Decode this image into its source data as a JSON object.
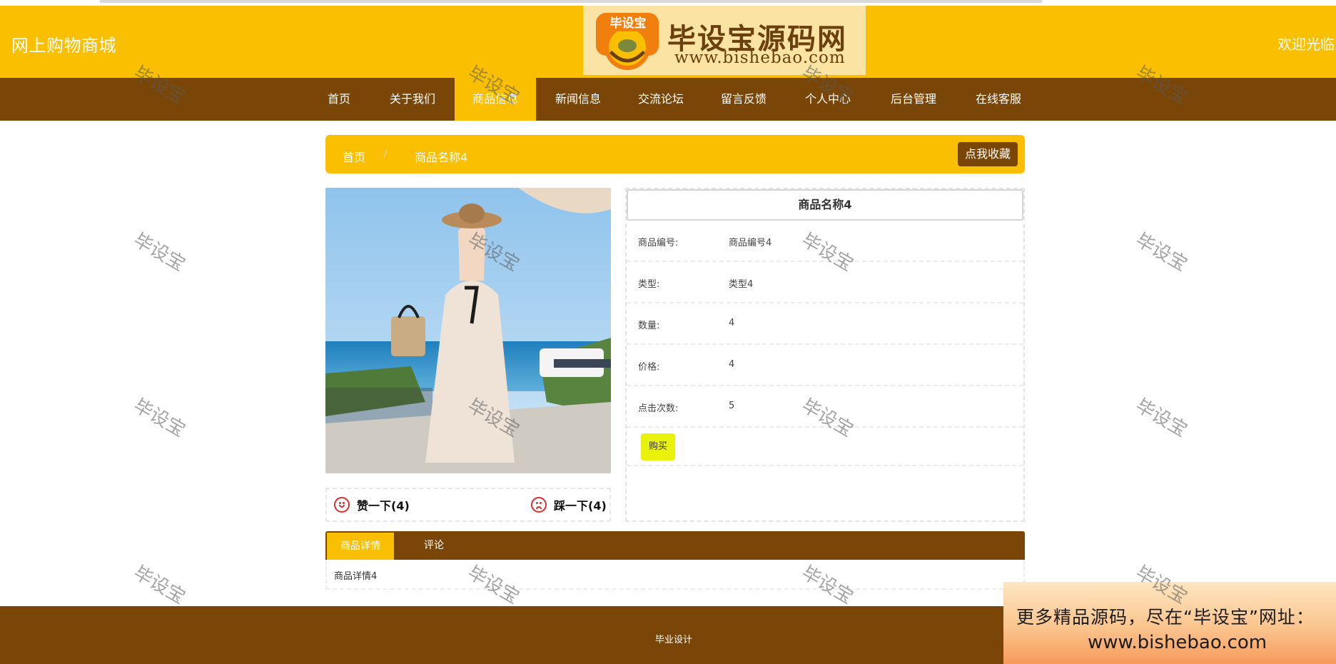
{
  "header": {
    "site_title": "网上购物商城",
    "welcome": "欢迎光临",
    "logo": {
      "badge_text": "毕设宝",
      "title": "毕设宝源码网",
      "url": "www.bishebao.com"
    }
  },
  "nav": {
    "items": [
      {
        "label": "首页"
      },
      {
        "label": "关于我们"
      },
      {
        "label": "商品信息"
      },
      {
        "label": "新闻信息"
      },
      {
        "label": "交流论坛"
      },
      {
        "label": "留言反馈"
      },
      {
        "label": "个人中心"
      },
      {
        "label": "后台管理"
      },
      {
        "label": "在线客服"
      }
    ],
    "active": "商品信息"
  },
  "breadcrumb": {
    "home": "首页",
    "separator": "/",
    "current": "商品名称4",
    "favorite_button": "点我收藏"
  },
  "votes": {
    "like": "赞一下(4)",
    "dislike": "踩一下(4)"
  },
  "product": {
    "name": "商品名称4",
    "fields": [
      {
        "key": "商品编号:",
        "value": "商品编号4"
      },
      {
        "key": "类型:",
        "value": "类型4"
      },
      {
        "key": "数量:",
        "value": "4"
      },
      {
        "key": "价格:",
        "value": "4"
      },
      {
        "key": "点击次数:",
        "value": "5"
      }
    ],
    "buy_button": "购买"
  },
  "tabs": {
    "items": [
      {
        "label": "商品详情"
      },
      {
        "label": "评论"
      }
    ],
    "active": "商品详情",
    "content": "商品详情4"
  },
  "footer": {
    "text": "毕业设计"
  },
  "promo": {
    "line1": "更多精品源码，尽在“毕设宝”网址：",
    "line2": "www.bishebao.com"
  },
  "watermark": {
    "text": "毕设宝"
  },
  "colors": {
    "brand_yellow": "#fbbf02",
    "brand_brown": "#7a4608",
    "buy_button": "#e8f20a",
    "vote_icon": "#d9302c"
  }
}
